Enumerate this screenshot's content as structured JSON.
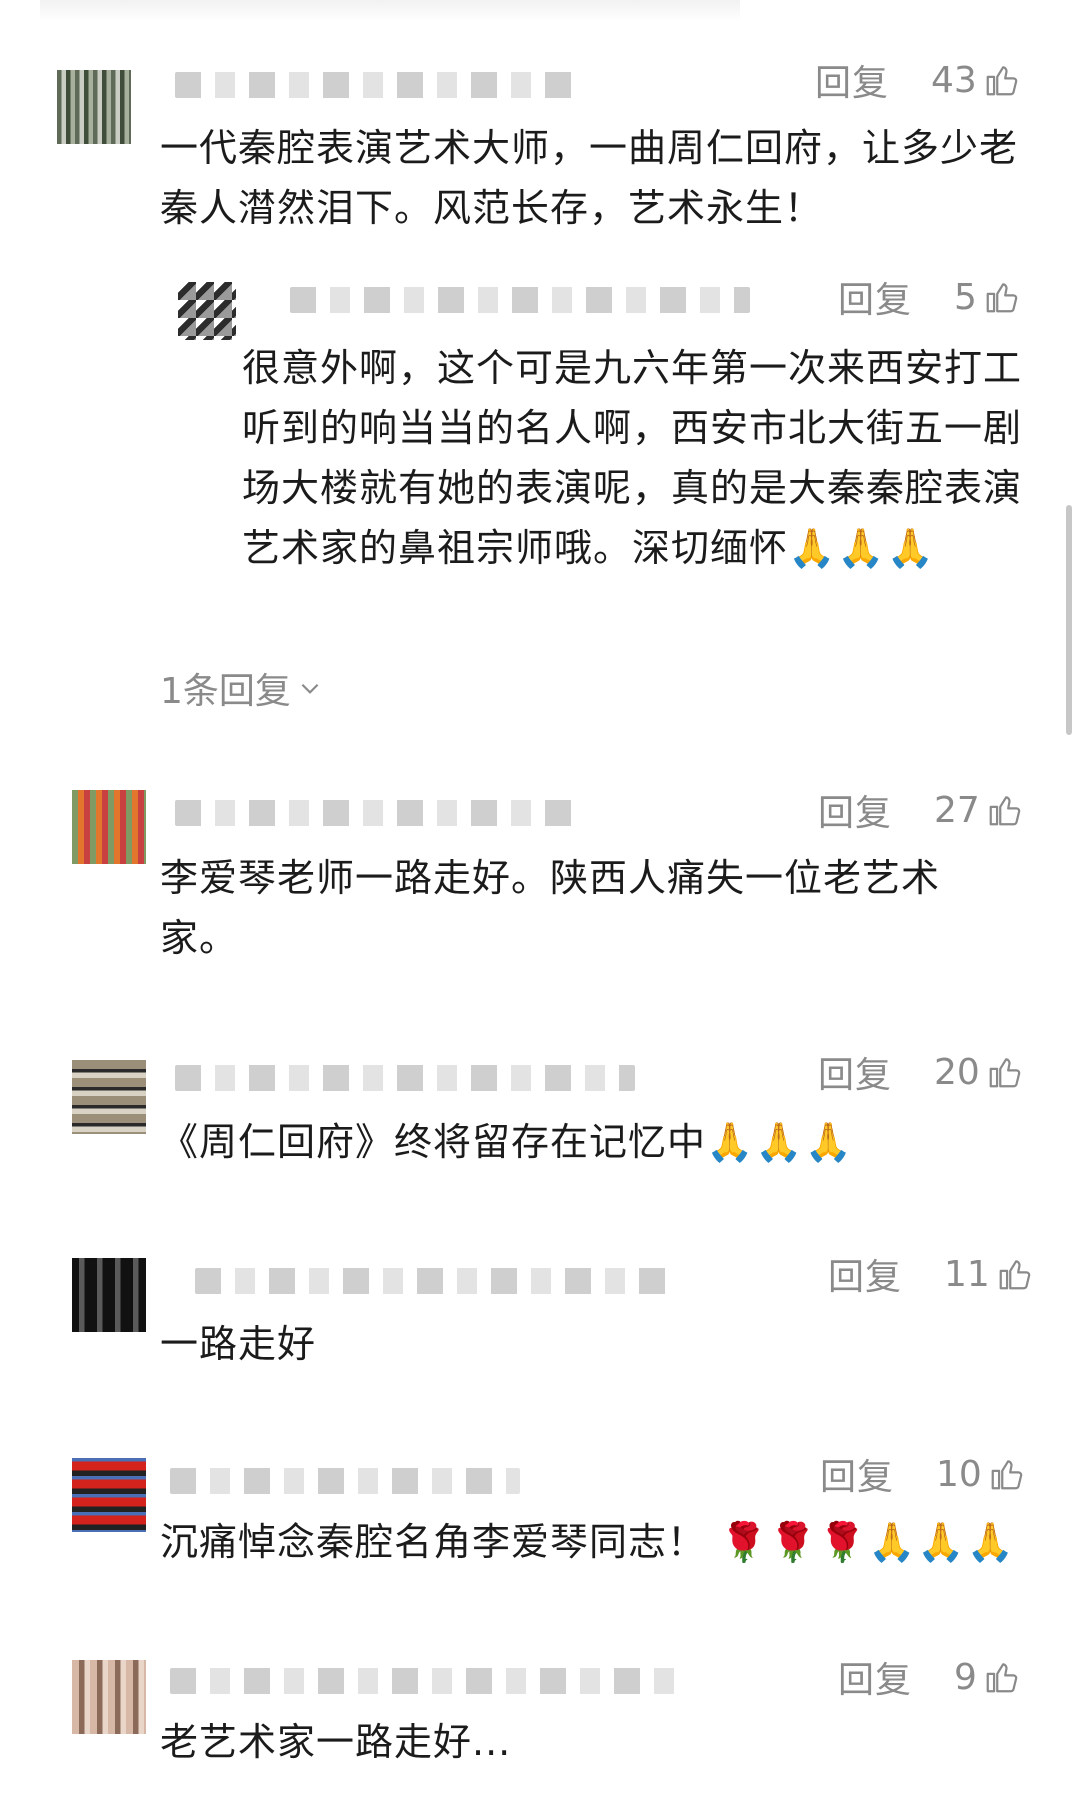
{
  "comments": [
    {
      "reply_label": "回复",
      "likes": "43",
      "text": "一代秦腔表演艺术大师，一曲周仁回府，让多少老秦人潸然泪下。风范长存，艺术永生！",
      "sub_reply": {
        "reply_label": "回复",
        "likes": "5",
        "text": "很意外啊，这个可是九六年第一次来西安打工听到的响当当的名人啊，西安市北大街五一剧场大楼就有她的表演呢，真的是大秦秦腔表演艺术家的鼻祖宗师哦。深切缅怀",
        "emoji": "🙏🙏🙏"
      },
      "more_replies": "1条回复"
    },
    {
      "reply_label": "回复",
      "likes": "27",
      "text": "李爱琴老师一路走好。陕西人痛失一位老艺术家。"
    },
    {
      "reply_label": "回复",
      "likes": "20",
      "text": "《周仁回府》终将留存在记忆中",
      "emoji": "🙏🙏🙏"
    },
    {
      "reply_label": "回复",
      "likes": "11",
      "text": "一路走好"
    },
    {
      "reply_label": "回复",
      "likes": "10",
      "text": "沉痛悼念秦腔名角李爱琴同志！",
      "emoji_flowers": "🌹🌹🌹",
      "emoji": "🙏🙏🙏"
    },
    {
      "reply_label": "回复",
      "likes": "9",
      "text": "老艺术家一路走好..."
    }
  ],
  "icons": {
    "like": "thumbs-up-icon",
    "expand": "chevron-down-icon"
  },
  "colors": {
    "meta_gray": "#8a8a8a",
    "text": "#1b1b1b"
  }
}
